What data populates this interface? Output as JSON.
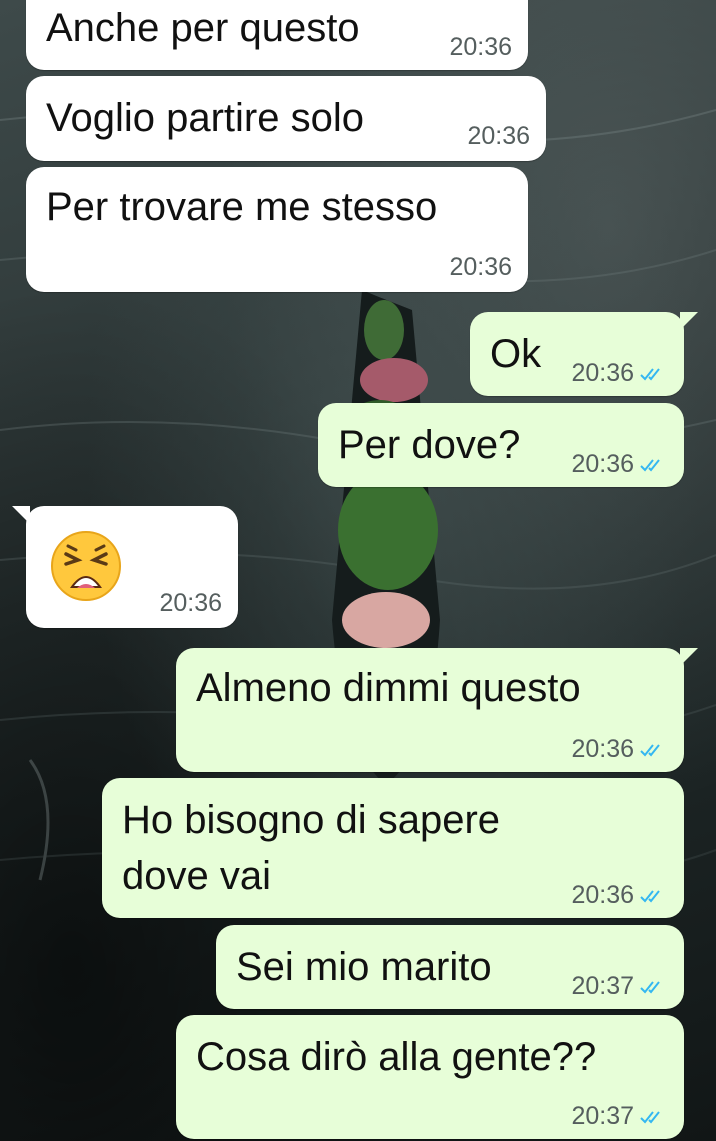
{
  "messages": [
    {
      "text": "Anche per questo",
      "time": "20:36",
      "direction": "incoming"
    },
    {
      "text": "Voglio partire solo",
      "time": "20:36",
      "direction": "incoming"
    },
    {
      "text": "Per trovare me stesso",
      "time": "20:36",
      "direction": "incoming"
    },
    {
      "text": "Ok",
      "time": "20:36",
      "direction": "outgoing",
      "status": "read"
    },
    {
      "text": "Per dove?",
      "time": "20:36",
      "direction": "outgoing",
      "status": "read"
    },
    {
      "emoji": "tired-face-emoji",
      "time": "20:36",
      "direction": "incoming"
    },
    {
      "text": "Almeno dimmi questo",
      "time": "20:36",
      "direction": "outgoing",
      "status": "read"
    },
    {
      "text_line1": "Ho bisogno di sapere",
      "text_line2": "dove vai",
      "time": "20:36",
      "direction": "outgoing",
      "status": "read"
    },
    {
      "text": "Sei mio marito",
      "time": "20:37",
      "direction": "outgoing",
      "status": "read"
    },
    {
      "text": "Cosa dirò alla gente??",
      "time": "20:37",
      "direction": "outgoing",
      "status": "read"
    }
  ],
  "colors": {
    "incoming_bubble": "#ffffff",
    "outgoing_bubble": "#e7fed8",
    "read_ticks": "#34b7f1",
    "timestamp": "#555e5e"
  },
  "icons": {
    "read_status": "double-check-icon"
  }
}
